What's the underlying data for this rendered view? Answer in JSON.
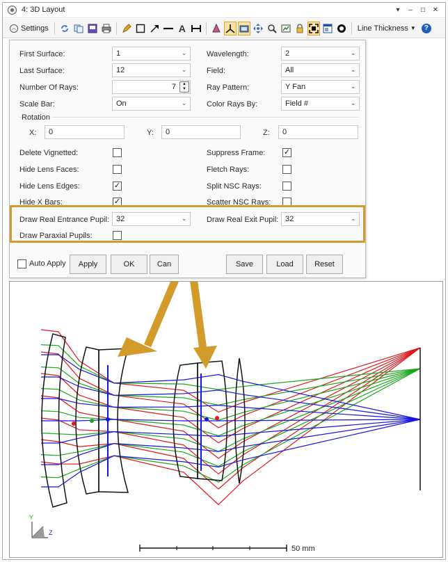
{
  "window": {
    "title": "4: 3D Layout"
  },
  "title_controls": {
    "dropdown": "▾",
    "minimize": "–",
    "restore": "□",
    "close": "✕"
  },
  "toolbar": {
    "settings_label": "Settings",
    "line_thickness_label": "Line Thickness",
    "icons": [
      "refresh-icon",
      "copy-icon",
      "save-image-icon",
      "print-icon",
      "pencil-icon",
      "rectangle-icon",
      "arrow-icon",
      "line-icon",
      "text-icon",
      "dimension-icon",
      "rotate-icon",
      "axis-icon",
      "camera-view-icon",
      "pan-icon",
      "zoom-icon",
      "export-icon",
      "lock-icon",
      "fit-icon",
      "window-icon",
      "record-icon",
      "help-icon"
    ]
  },
  "settings": {
    "first_surface": {
      "label": "First Surface:",
      "value": "1"
    },
    "last_surface": {
      "label": "Last Surface:",
      "value": "12"
    },
    "number_of_rays": {
      "label": "Number Of Rays:",
      "value": "7"
    },
    "scale_bar": {
      "label": "Scale Bar:",
      "value": "On"
    },
    "wavelength": {
      "label": "Wavelength:",
      "value": "2"
    },
    "field": {
      "label": "Field:",
      "value": "All"
    },
    "ray_pattern": {
      "label": "Ray Pattern:",
      "value": "Y Fan"
    },
    "color_rays_by": {
      "label": "Color Rays By:",
      "value": "Field #"
    },
    "rotation": {
      "label": "Rotation",
      "x_label": "X:",
      "x_value": "0",
      "y_label": "Y:",
      "y_value": "0",
      "z_label": "Z:",
      "z_value": "0"
    },
    "delete_vignetted": {
      "label": "Delete Vignetted:",
      "checked": false
    },
    "hide_lens_faces": {
      "label": "Hide Lens Faces:",
      "checked": false
    },
    "hide_lens_edges": {
      "label": "Hide Lens Edges:",
      "checked": true
    },
    "hide_x_bars": {
      "label": "Hide X Bars:",
      "checked": true
    },
    "suppress_frame": {
      "label": "Suppress Frame:",
      "checked": true
    },
    "fletch_rays": {
      "label": "Fletch Rays:",
      "checked": false
    },
    "split_nsc_rays": {
      "label": "Split NSC Rays:",
      "checked": false
    },
    "scatter_nsc_rays": {
      "label": "Scatter NSC Rays:",
      "checked": false
    },
    "draw_real_entrance_pupil": {
      "label": "Draw Real Entrance Pupil:",
      "value": "32"
    },
    "draw_real_exit_pupil": {
      "label": "Draw Real Exit Pupil:",
      "value": "32"
    },
    "draw_paraxial_pupils": {
      "label": "Draw Paraxial Pupils:",
      "checked": false
    },
    "check_mark": "✓"
  },
  "buttons": {
    "auto_apply": "Auto Apply",
    "apply": "Apply",
    "ok": "OK",
    "cancel": "Can",
    "save": "Save",
    "load": "Load",
    "reset": "Reset"
  },
  "plot": {
    "scale_label": "50 mm",
    "axis_y": "Y",
    "axis_z": "Z",
    "colors": {
      "field1": "#e0191c",
      "field2": "#1aa81a",
      "field3": "#1515e6",
      "lens": "#111111",
      "annotation_arrow": "#d39b2a"
    }
  }
}
